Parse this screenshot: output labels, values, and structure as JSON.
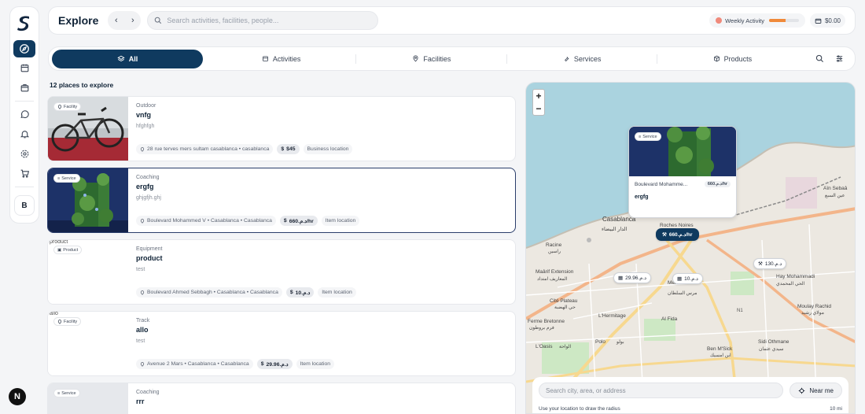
{
  "app": {
    "title": "Explore"
  },
  "search": {
    "placeholder": "Search activities, facilities, people..."
  },
  "weekly": {
    "label": "Weekly Activity",
    "progress": 0.55
  },
  "wallet": {
    "balance": "$0.00"
  },
  "rail": {
    "avatar": "B",
    "bottom_badge": "N"
  },
  "tabs": [
    {
      "label": "All",
      "icon": "layers-icon"
    },
    {
      "label": "Activities",
      "icon": "calendar-icon"
    },
    {
      "label": "Facilities",
      "icon": "pin-icon"
    },
    {
      "label": "Services",
      "icon": "wrench-icon"
    },
    {
      "label": "Products",
      "icon": "box-icon"
    }
  ],
  "results": {
    "count_label": "12 places to explore"
  },
  "cards": [
    {
      "badge": "Facility",
      "alt": "",
      "category": "Outdoor",
      "name": "vnfg",
      "desc": "hfghfgh",
      "address": "28 rue terves mers sultam casablanca • casablanca",
      "price": "$45",
      "location": "Business location",
      "thumb": "bike"
    },
    {
      "badge": "Service",
      "alt": "",
      "category": "Coaching",
      "name": "ergfg",
      "desc": "ghjgfjh.ghj",
      "address": "Boulevard Mohammed V • Casablanca • Casablanca",
      "price": "660.د.م/hr",
      "location": "Item location",
      "thumb": "plant"
    },
    {
      "badge": "Product",
      "alt": "product",
      "category": "Equipment",
      "name": "product",
      "desc": "test",
      "address": "Boulevard Ahmed Sebbagh • Casablanca • Casablanca",
      "price": "10.د.م",
      "location": "Item location",
      "thumb": "blank"
    },
    {
      "badge": "Facility",
      "alt": "allo",
      "category": "Track",
      "name": "allo",
      "desc": "test",
      "address": "Avenue 2 Mars • Casablanca • Casablanca",
      "price": "29.96.د.م",
      "location": "Item location",
      "thumb": "blank"
    },
    {
      "badge": "Service",
      "alt": "",
      "category": "Coaching",
      "name": "rrr",
      "desc": "",
      "address": "",
      "price": "",
      "location": "",
      "thumb": "grey"
    }
  ],
  "map": {
    "popup": {
      "badge": "Service",
      "address": "Boulevard Mohamme...",
      "price": "660.د.م/hr",
      "name": "ergfg"
    },
    "pins": [
      {
        "label": "660.د.م/hr",
        "kind": "dark",
        "icon": "wrench-icon"
      },
      {
        "label": "130.د.م",
        "kind": "light",
        "icon": "wrench-icon"
      },
      {
        "label": "29.96.د.م",
        "kind": "light",
        "icon": "building-icon"
      },
      {
        "label": "10.د.م",
        "kind": "light",
        "icon": "building-icon"
      }
    ],
    "labels": {
      "casablanca": "Casablanca",
      "casablanca_ar": "الدار البيضاء",
      "roches": "Roches Noires",
      "racine": "Racine",
      "racine_ar": "راسين",
      "maarif": "Maârif Extension",
      "maarif_ar": "المعاريف امتداد",
      "cite": "Cité Plateau",
      "cite_ar": "حي الهضبة",
      "hermitage": "L'Hermitage",
      "polo": "Polo",
      "polo_ar": "بولو",
      "oasis": "L'Oasis",
      "oasis_ar": "الواحة",
      "fidia": "Al Fida",
      "hay": "Hay Mohammadi",
      "hay_ar": "الحي المحمدي",
      "moulay": "Moulay Rachid",
      "moulay_ar": "مولاي رشيد",
      "benm": "Ben M'Sick",
      "benm_ar": "ابن امسيك",
      "sidi": "Sidi Othmane",
      "sidi_ar": "سيدي عثمان",
      "ain": "Aïn Sebaâ",
      "ain_ar": "عين السبع",
      "mers": "Mers Sultan",
      "mers_ar": "مرس السلطان",
      "ferme": "Ferme Bretonne",
      "ferme_ar": "فرم بروطون",
      "n1": "N1"
    },
    "zoom_in": "+",
    "zoom_out": "−",
    "search_placeholder": "Search city, area, or address",
    "near_label": "Near me",
    "foot_left": "Use your location to draw the radius",
    "foot_right": "10 mi"
  },
  "colors": {
    "primary": "#0f3a5f",
    "accent": "#f08a3a"
  }
}
